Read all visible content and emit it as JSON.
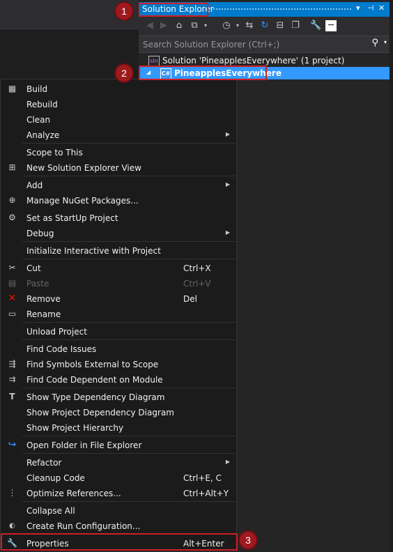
{
  "solution_explorer": {
    "title": "Solution Explorer",
    "title_buttons": {
      "dropdown": "▾",
      "pin": "⊣",
      "close": "✕"
    },
    "toolbar_icons": [
      "back-icon",
      "forward-icon",
      "home-icon",
      "switch-views-icon",
      "pending-changes-filter-icon",
      "sync-icon",
      "refresh-icon",
      "collapse-all-icon",
      "show-all-files-icon",
      "properties-wrench-icon",
      "preview-selected-icon"
    ],
    "search_placeholder": "Search Solution Explorer (Ctrl+;)",
    "tree": {
      "solution_label": "Solution 'PineapplesEverywhere' (1 project)",
      "project_label": "PineapplesEverywhere"
    }
  },
  "context_menu": {
    "items": [
      {
        "label": "Build",
        "icon": "build-icon"
      },
      {
        "label": "Rebuild"
      },
      {
        "label": "Clean"
      },
      {
        "label": "Analyze",
        "submenu": true
      },
      {
        "label": "Scope to This"
      },
      {
        "label": "New Solution Explorer View",
        "icon": "new-view-icon"
      },
      {
        "label": "Add",
        "submenu": true
      },
      {
        "label": "Manage NuGet Packages...",
        "icon": "nuget-icon"
      },
      {
        "label": "Set as StartUp Project",
        "icon": "gear-icon"
      },
      {
        "label": "Debug",
        "submenu": true
      },
      {
        "label": "Initialize Interactive with Project"
      },
      {
        "label": "Cut",
        "shortcut": "Ctrl+X",
        "icon": "scissors-icon"
      },
      {
        "label": "Paste",
        "shortcut": "Ctrl+V",
        "icon": "paste-icon",
        "disabled": true
      },
      {
        "label": "Remove",
        "shortcut": "Del",
        "icon": "remove-x-icon"
      },
      {
        "label": "Rename",
        "icon": "rename-icon"
      },
      {
        "label": "Unload Project"
      },
      {
        "label": "Find Code Issues"
      },
      {
        "label": "Find Symbols External to Scope",
        "icon": "find-symbols-icon"
      },
      {
        "label": "Find Code Dependent on Module",
        "icon": "find-dependent-icon"
      },
      {
        "label": "Show Type Dependency Diagram",
        "icon": "type-diagram-icon"
      },
      {
        "label": "Show Project Dependency Diagram"
      },
      {
        "label": "Show Project Hierarchy"
      },
      {
        "label": "Open Folder in File Explorer",
        "icon": "open-folder-icon"
      },
      {
        "label": "Refactor",
        "submenu": true
      },
      {
        "label": "Cleanup Code",
        "shortcut": "Ctrl+E, C"
      },
      {
        "label": "Optimize References...",
        "shortcut": "Ctrl+Alt+Y",
        "icon": "optimize-references-icon"
      },
      {
        "label": "Collapse All"
      },
      {
        "label": "Create Run Configuration...",
        "icon": "run-config-icon"
      },
      {
        "label": "Properties",
        "shortcut": "Alt+Enter",
        "icon": "wrench-icon"
      }
    ]
  },
  "callouts": [
    "1",
    "2",
    "3"
  ],
  "colors": {
    "accent": "#007acc",
    "selection": "#3399ff",
    "callout": "#d11f26",
    "menu_bg": "#1b1b1c"
  }
}
